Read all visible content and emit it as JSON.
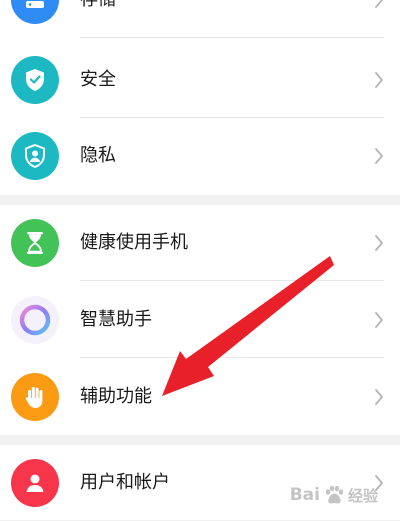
{
  "settings": {
    "items": [
      {
        "label": "存储",
        "icon": "storage-icon",
        "color": "#2f8cf5"
      },
      {
        "label": "安全",
        "icon": "shield-check-icon",
        "color": "#1db9c3"
      },
      {
        "label": "隐私",
        "icon": "privacy-shield-icon",
        "color": "#1db9c3"
      },
      {
        "label": "健康使用手机",
        "icon": "hourglass-icon",
        "color": "#43c257"
      },
      {
        "label": "智慧助手",
        "icon": "assistant-ring-icon",
        "color": "#9a7bf2"
      },
      {
        "label": "辅助功能",
        "icon": "hand-icon",
        "color": "#fb9b14"
      },
      {
        "label": "用户和帐户",
        "icon": "user-icon",
        "color": "#f7364b"
      }
    ]
  },
  "annotation": {
    "arrow_color": "#e8202a"
  },
  "watermark": {
    "brand": "Bai",
    "paw_icon": "baidu-paw-icon",
    "suffix": "经验"
  }
}
